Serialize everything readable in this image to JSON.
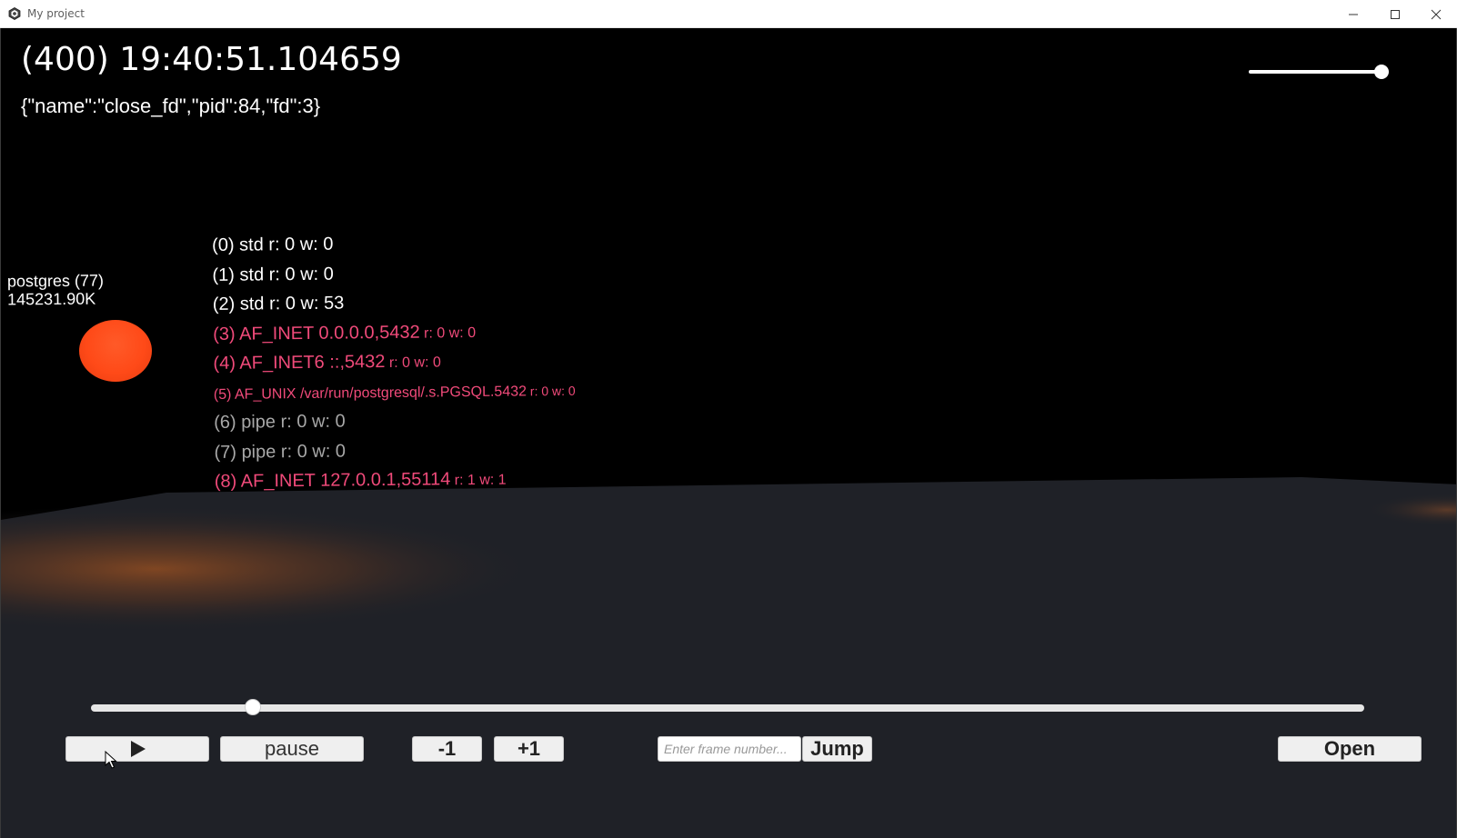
{
  "window": {
    "title": "My project",
    "icon": "unity-logo-icon",
    "controls": [
      "minimize-icon",
      "maximize-icon",
      "close-icon"
    ]
  },
  "hud": {
    "timestamp": "(400) 19:40:51.104659",
    "event": "{\"name\":\"close_fd\",\"pid\":84,\"fd\":3}"
  },
  "speed_slider": {
    "value": 1.0
  },
  "process": {
    "name_line": "postgres (77)",
    "size_line": "145231.90K",
    "color": "#ff4a18"
  },
  "fds": [
    {
      "main": "(0) std r: 0 w: 0",
      "tail": "",
      "kind": "std"
    },
    {
      "main": "(1) std r: 0 w: 0",
      "tail": "",
      "kind": "std"
    },
    {
      "main": "(2) std r: 0 w: 53",
      "tail": "",
      "kind": "std"
    },
    {
      "main": "(3) AF_INET 0.0.0.0,5432",
      "tail": " r: 0 w: 0",
      "kind": "net"
    },
    {
      "main": "(4) AF_INET6 ::,5432",
      "tail": " r: 0 w: 0",
      "kind": "net"
    },
    {
      "main": "(5) AF_UNIX /var/run/postgresql/.s.PGSQL.5432",
      "tail": " r: 0 w: 0",
      "kind": "net"
    },
    {
      "main": "(6) pipe r: 0 w: 0",
      "tail": "",
      "kind": "pipe"
    },
    {
      "main": "(7) pipe r: 0 w: 0",
      "tail": "",
      "kind": "pipe"
    },
    {
      "main": "(8) AF_INET 127.0.0.1,55114",
      "tail": " r: 1 w: 1",
      "kind": "net"
    }
  ],
  "colors": {
    "std": "#ffffff",
    "net": "#f04a7a",
    "pipe": "#a8a8a8",
    "ground": "#1f2127"
  },
  "timeline": {
    "progress": 0.127
  },
  "controls": {
    "play_icon": "play-icon",
    "pause_label": "pause",
    "minus_label": "-1",
    "plus_label": "+1",
    "frame_placeholder": "Enter frame number...",
    "jump_label": "Jump",
    "open_label": "Open"
  }
}
